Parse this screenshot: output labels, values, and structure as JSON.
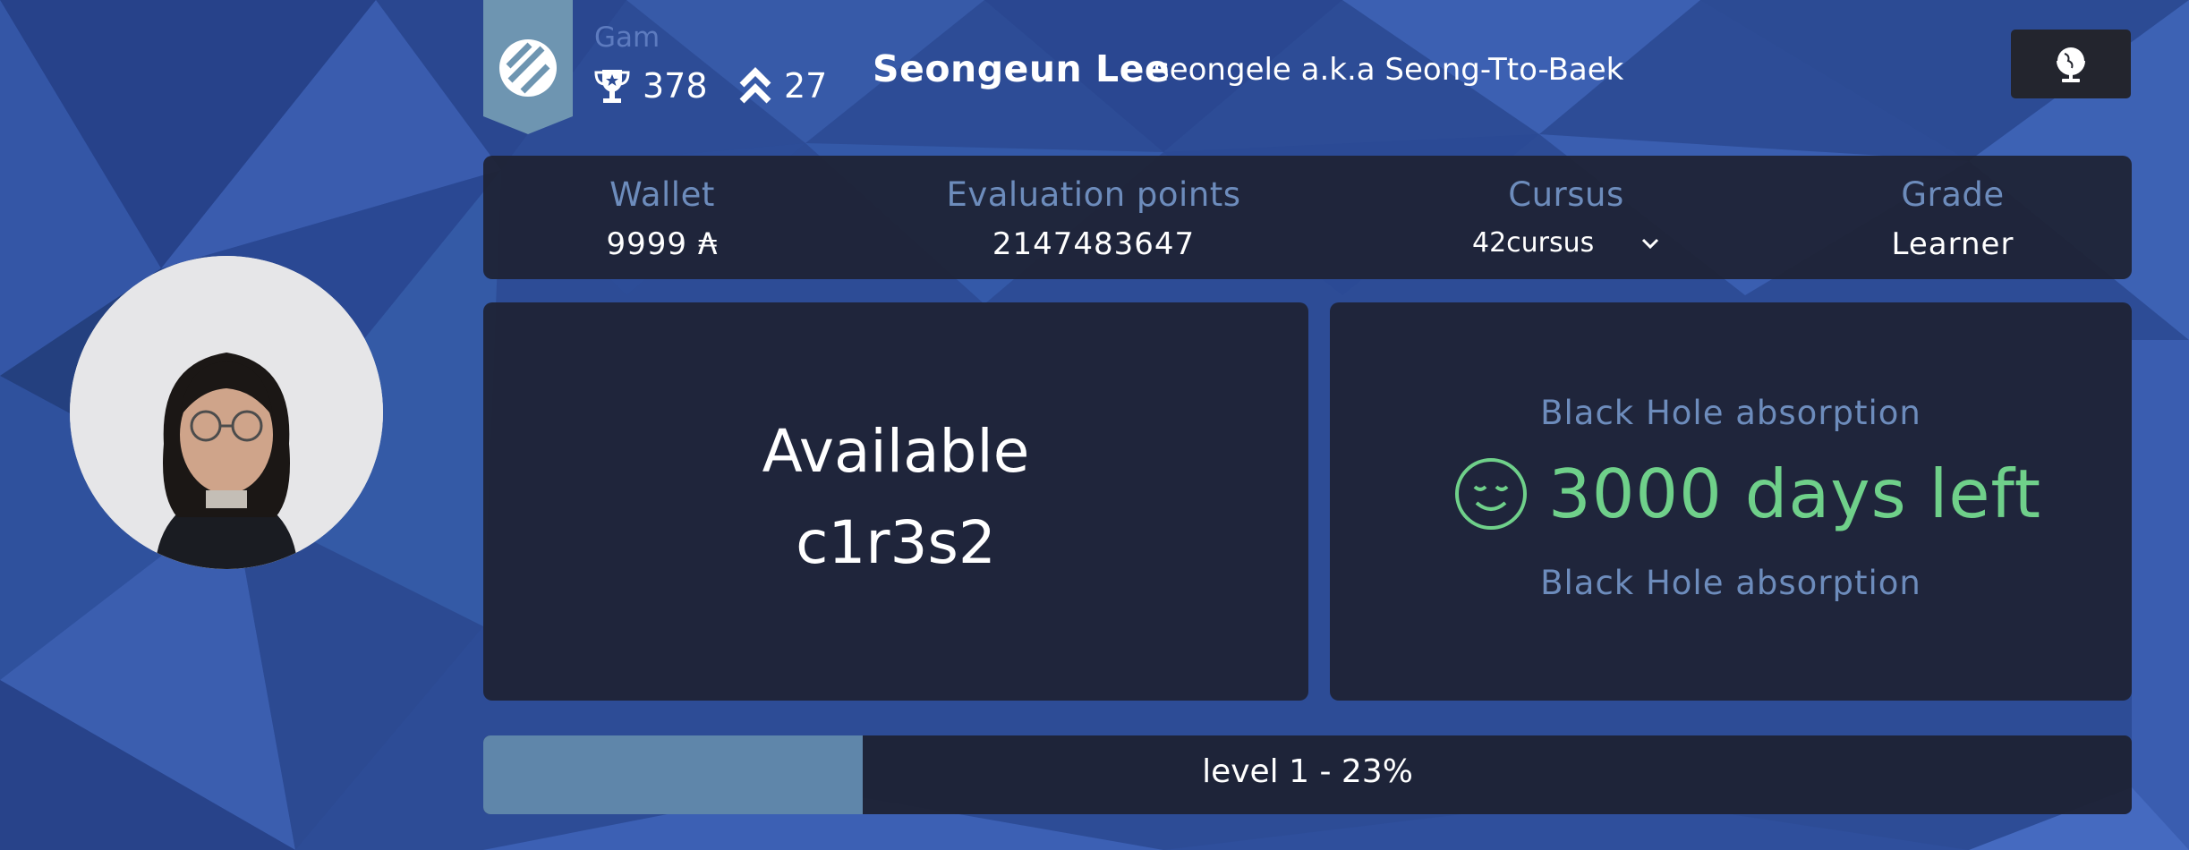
{
  "coalition": {
    "name": "Gam",
    "icon": "coalition-logo-icon"
  },
  "stats": {
    "trophy_icon": "trophy-icon",
    "points": "378",
    "rank_icon": "rank-chevrons-icon",
    "rank": "27"
  },
  "user": {
    "name": "Seongeun Lee",
    "alias": "seongele a.k.a Seong-Tto-Baek"
  },
  "toolbar": {
    "globe_icon": "globe-icon"
  },
  "info": {
    "wallet_label": "Wallet",
    "wallet_value": "9999 ₳",
    "eval_label": "Evaluation points",
    "eval_value": "2147483647",
    "cursus_label": "Cursus",
    "cursus_value": "42cursus",
    "grade_label": "Grade",
    "grade_value": "Learner"
  },
  "location": {
    "status": "Available",
    "seat": "c1r3s2"
  },
  "blackhole": {
    "label_top": "Black Hole absorption",
    "days_left": "3000 days left",
    "label_bottom": "Black Hole absorption",
    "icon": "smiley-icon",
    "color": "#6fd08a"
  },
  "level": {
    "text": "level 1 - 23%",
    "progress": 0.23
  },
  "colors": {
    "background": "#2b4a94",
    "panel": "#1e2234",
    "label": "#6d8cbc",
    "banner": "#6e95b1",
    "level_fill": "#5f86aa"
  }
}
